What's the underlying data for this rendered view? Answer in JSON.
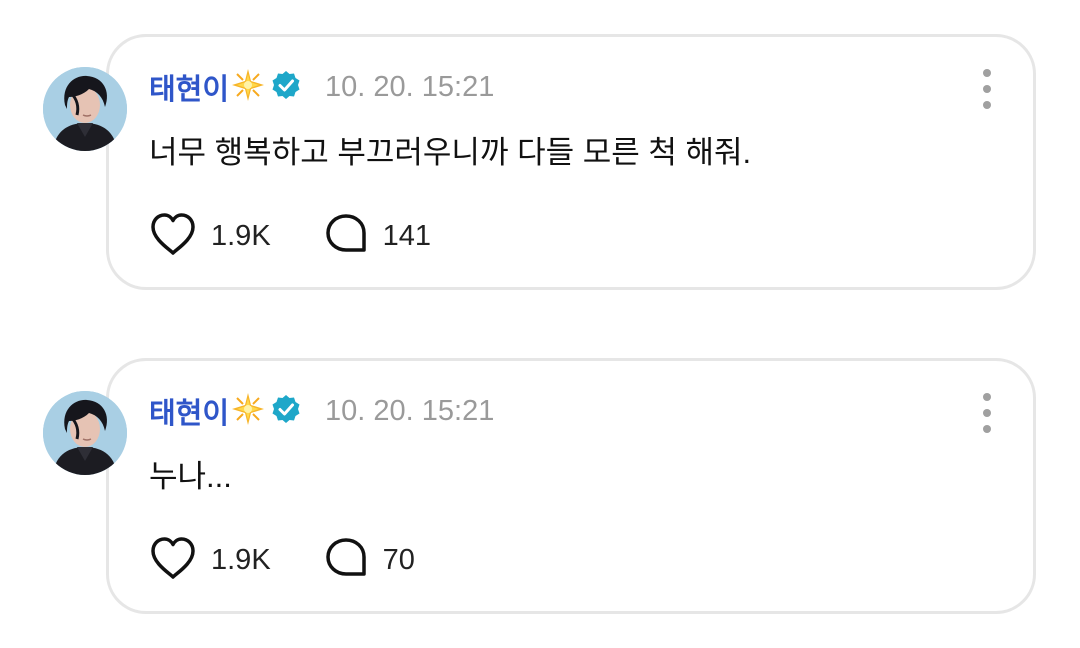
{
  "posts": [
    {
      "author": "태현이",
      "author_badge_icon": "sparkle-icon",
      "verified_icon": "verified-icon",
      "timestamp": "10. 20. 15:21",
      "text": "너무 행복하고 부끄러우니까 다들 모른 척 해줘.",
      "likes": "1.9K",
      "comments": "141"
    },
    {
      "author": "태현이",
      "author_badge_icon": "sparkle-icon",
      "verified_icon": "verified-icon",
      "timestamp": "10. 20. 15:21",
      "text": "누나...",
      "likes": "1.9K",
      "comments": "70"
    }
  ],
  "colors": {
    "username": "#2f56c9",
    "verified_badge": "#1ea7c9",
    "timestamp": "#9a9a9a",
    "card_border": "#e6e6e6"
  },
  "icons": {
    "like": "heart-icon",
    "comment": "comment-bubble-icon",
    "more": "more-vertical-icon"
  }
}
